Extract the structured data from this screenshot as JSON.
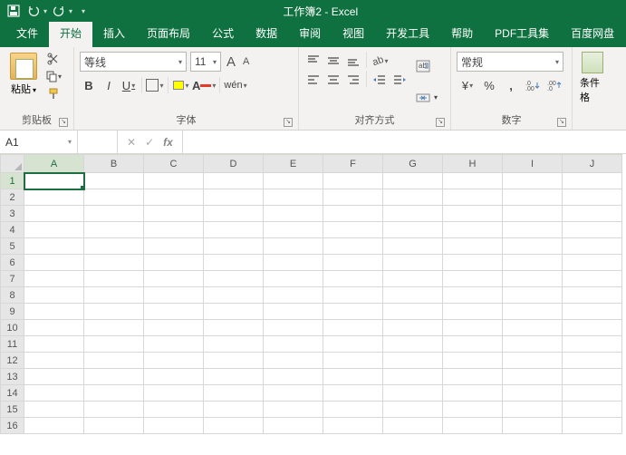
{
  "title": "工作簿2 - Excel",
  "qat": {
    "save": "save",
    "undo": "undo",
    "redo": "redo"
  },
  "tabs": [
    "文件",
    "开始",
    "插入",
    "页面布局",
    "公式",
    "数据",
    "审阅",
    "视图",
    "开发工具",
    "帮助",
    "PDF工具集",
    "百度网盘"
  ],
  "activeTab": 1,
  "groups": {
    "clipboard": {
      "label": "剪贴板",
      "paste": "粘贴"
    },
    "font": {
      "label": "字体",
      "name": "等线",
      "size": "11",
      "increase": "A",
      "decrease": "A",
      "bold": "B",
      "italic": "I",
      "underline": "U",
      "phonetic": "wén"
    },
    "align": {
      "label": "对齐方式",
      "wrap": "ab",
      "merge": "□"
    },
    "number": {
      "label": "数字",
      "format": "常规",
      "currency": "¥",
      "percent": "%",
      "comma": ",",
      "dec_inc": ".00",
      "dec_dec": ".0"
    },
    "cond": {
      "label": "条件格"
    }
  },
  "namebox": "A1",
  "fx": "fx",
  "columns": [
    "A",
    "B",
    "C",
    "D",
    "E",
    "F",
    "G",
    "H",
    "I",
    "J"
  ],
  "rows": [
    "1",
    "2",
    "3",
    "4",
    "5",
    "6",
    "7",
    "8",
    "9",
    "10",
    "11",
    "12",
    "13",
    "14",
    "15",
    "16"
  ]
}
